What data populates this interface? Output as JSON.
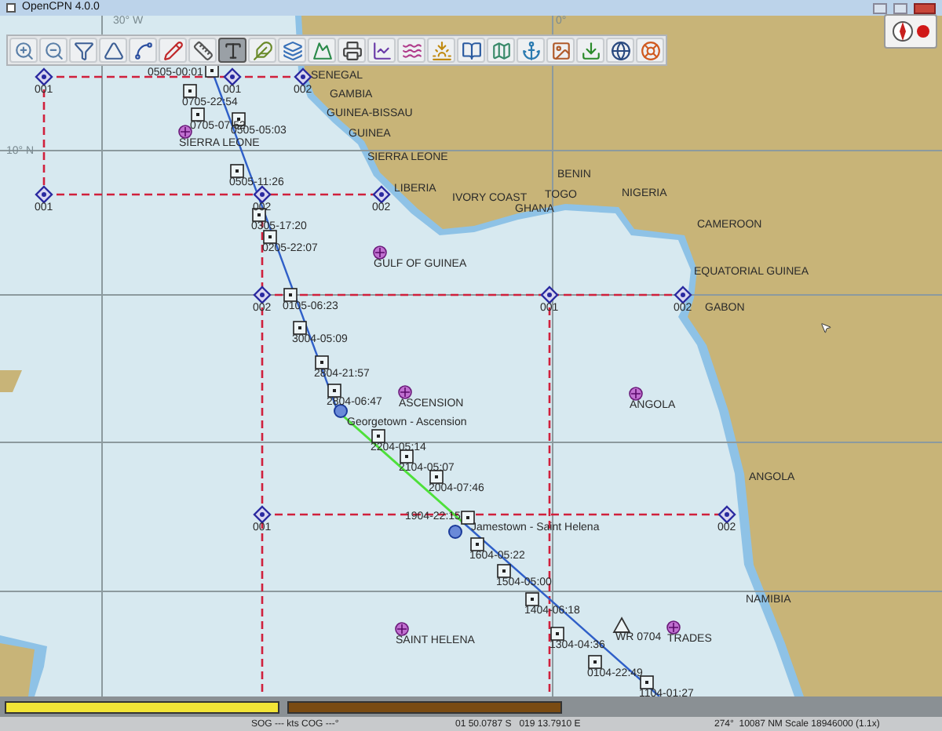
{
  "window": {
    "title": "OpenCPN 4.0.0"
  },
  "toolbar": [
    {
      "selected": false
    },
    {
      "selected": false
    },
    {
      "selected": false
    },
    {
      "selected": false
    },
    {
      "selected": false
    },
    {
      "selected": false
    },
    {
      "selected": false
    },
    {
      "selected": true
    },
    {
      "selected": false
    },
    {
      "selected": false
    },
    {
      "selected": false
    },
    {
      "selected": false
    },
    {
      "selected": false
    },
    {
      "selected": false
    },
    {
      "selected": false
    },
    {
      "selected": false
    },
    {
      "selected": false
    },
    {
      "selected": false
    },
    {
      "selected": false
    },
    {
      "selected": false
    },
    {
      "selected": false
    },
    {
      "selected": false
    }
  ],
  "map": {
    "grid_labels": [
      "30° W",
      "10° N",
      "0°"
    ],
    "regions": [
      "SENEGAL",
      "GAMBIA",
      "GUINEA-BISSAU",
      "GUINEA",
      "SIERRA LEONE",
      "LIBERIA",
      "IVORY COAST",
      "BENIN",
      "TOGO",
      "GHANA",
      "NIGERIA",
      "CAMEROON",
      "EQUATORIAL GUINEA",
      "GABON",
      "ANGOLA",
      "NAMIBIA"
    ],
    "waypoints": [
      "001",
      "001",
      "002",
      "001",
      "002",
      "002",
      "002",
      "001",
      "002",
      "001",
      "002"
    ],
    "track_points": [
      "0505-00:01",
      "0705-22:54",
      "0705-07:52",
      "0505-05:03",
      "0505-11:26",
      "0305-17:20",
      "0205-22:07",
      "0105-06:23",
      "3004-05:09",
      "2804-21:57",
      "2804-06:47",
      "2204-05:14",
      "2104-05:07",
      "2004-07:46",
      "1904-22:15",
      "1604-05:22",
      "1504-05:00",
      "1404-06:18",
      "1304-04:36",
      "0104-22:49",
      "1104-01:27"
    ],
    "ports": [
      "Georgetown - Ascension",
      "Jamestown - Saint Helena"
    ],
    "marks": [
      {
        "kind": "point",
        "label": "SIERRA LEONE"
      },
      {
        "kind": "point",
        "label": "GULF OF GUINEA"
      },
      {
        "kind": "point",
        "label": "ASCENSION"
      },
      {
        "kind": "point",
        "label": "ANGOLA"
      },
      {
        "kind": "point",
        "label": "SAINT HELENA"
      },
      {
        "kind": "weather",
        "label": "WR 0704"
      },
      {
        "kind": "point",
        "label": "TRADES"
      }
    ]
  },
  "chart_bars": [
    {
      "color": "#f2e436"
    },
    {
      "color": "#7a4b12"
    }
  ],
  "status_bar": [
    "SOG --- kts COG ---°",
    "01 50.0787 S   019 13.7910 E",
    "274°  10087 NM",
    "Scale 18946000 (1.1x)"
  ]
}
